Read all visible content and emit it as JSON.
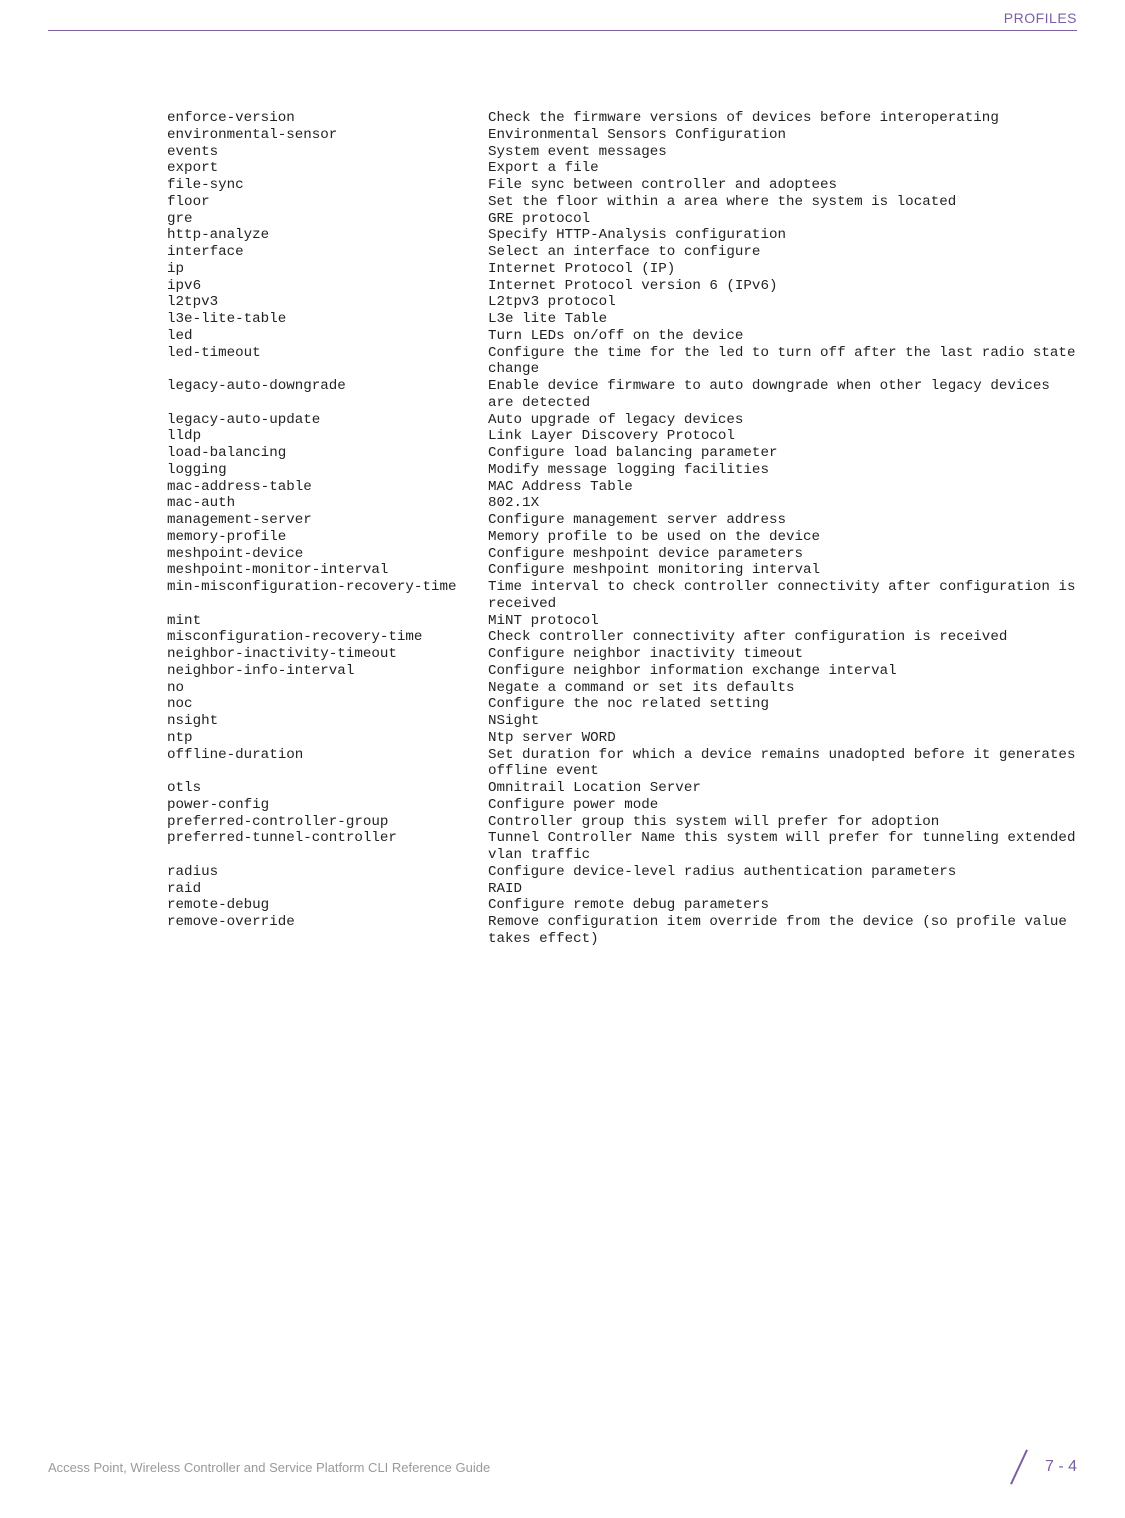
{
  "header": {
    "label": "PROFILES"
  },
  "rows": [
    {
      "cmd": "  enforce-version",
      "desc": "Check the firmware versions of devices before interoperating"
    },
    {
      "cmd": "  environmental-sensor",
      "desc": "Environmental Sensors Configuration"
    },
    {
      "cmd": "  events",
      "desc": "System event messages"
    },
    {
      "cmd": "  export",
      "desc": "Export a file"
    },
    {
      "cmd": "  file-sync",
      "desc": "File sync between controller and adoptees"
    },
    {
      "cmd": "  floor",
      "desc": "Set the floor within a area where the system is located"
    },
    {
      "cmd": "  gre",
      "desc": "GRE protocol"
    },
    {
      "cmd": "  http-analyze",
      "desc": "Specify HTTP-Analysis configuration"
    },
    {
      "cmd": "  interface",
      "desc": "Select an interface to configure"
    },
    {
      "cmd": "  ip",
      "desc": "Internet Protocol (IP)"
    },
    {
      "cmd": "  ipv6",
      "desc": "Internet Protocol version 6 (IPv6)"
    },
    {
      "cmd": "  l2tpv3",
      "desc": "L2tpv3 protocol"
    },
    {
      "cmd": "  l3e-lite-table",
      "desc": "L3e lite Table"
    },
    {
      "cmd": "  led",
      "desc": "Turn LEDs on/off on the device"
    },
    {
      "cmd": "  led-timeout",
      "desc": "Configure the time for the led to turn off after the last radio state change"
    },
    {
      "cmd": "  legacy-auto-downgrade",
      "desc": "Enable device firmware to auto downgrade when other legacy devices are detected"
    },
    {
      "cmd": "  legacy-auto-update",
      "desc": "Auto upgrade of legacy devices"
    },
    {
      "cmd": "  lldp",
      "desc": "Link Layer Discovery Protocol"
    },
    {
      "cmd": "  load-balancing",
      "desc": "Configure load balancing parameter"
    },
    {
      "cmd": "  logging",
      "desc": "Modify message logging facilities"
    },
    {
      "cmd": "  mac-address-table",
      "desc": "MAC Address Table"
    },
    {
      "cmd": "  mac-auth",
      "desc": "802.1X"
    },
    {
      "cmd": "  management-server",
      "desc": "Configure management server address"
    },
    {
      "cmd": "  memory-profile",
      "desc": "Memory profile to be used on the device"
    },
    {
      "cmd": "  meshpoint-device",
      "desc": "Configure meshpoint device parameters"
    },
    {
      "cmd": "  meshpoint-monitor-interval",
      "desc": "Configure meshpoint monitoring interval"
    },
    {
      "cmd": "  min-misconfiguration-recovery-time",
      "desc": "Time interval to check controller connectivity after configuration is received"
    },
    {
      "cmd": "  mint",
      "desc": "MiNT protocol"
    },
    {
      "cmd": "  misconfiguration-recovery-time",
      "desc": "Check controller connectivity after configuration is received"
    },
    {
      "cmd": "  neighbor-inactivity-timeout",
      "desc": "Configure neighbor inactivity timeout"
    },
    {
      "cmd": "  neighbor-info-interval",
      "desc": "Configure neighbor information exchange interval"
    },
    {
      "cmd": "  no",
      "desc": "Negate a command or set its defaults"
    },
    {
      "cmd": "  noc",
      "desc": "Configure the noc related setting"
    },
    {
      "cmd": "  nsight",
      "desc": "NSight"
    },
    {
      "cmd": "  ntp",
      "desc": "Ntp server WORD"
    },
    {
      "cmd": "  offline-duration",
      "desc": "Set duration for which a device remains unadopted before it generates offline event"
    },
    {
      "cmd": "  otls",
      "desc": "Omnitrail Location Server"
    },
    {
      "cmd": "  power-config",
      "desc": "Configure power mode"
    },
    {
      "cmd": "  preferred-controller-group",
      "desc": "Controller group this system will prefer for adoption"
    },
    {
      "cmd": "  preferred-tunnel-controller",
      "desc": "Tunnel Controller Name this system will prefer for tunneling extended vlan traffic"
    },
    {
      "cmd": "  radius",
      "desc": "Configure device-level radius authentication parameters"
    },
    {
      "cmd": "  raid",
      "desc": "RAID"
    },
    {
      "cmd": "  remote-debug",
      "desc": "Configure remote debug parameters"
    },
    {
      "cmd": "  remove-override",
      "desc": "Remove configuration item override from the device (so profile value takes effect)"
    }
  ],
  "footer": {
    "text": "Access Point, Wireless Controller and Service Platform CLI Reference Guide",
    "page": "7 - 4"
  }
}
